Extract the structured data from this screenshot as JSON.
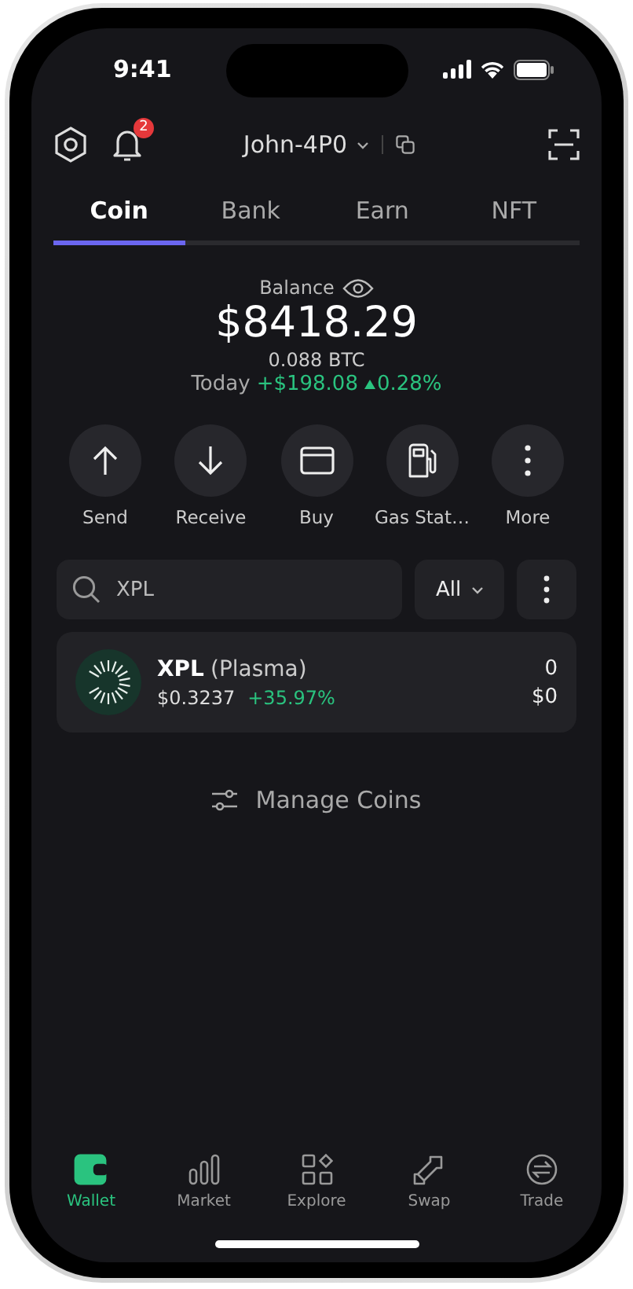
{
  "status_bar": {
    "time": "9:41"
  },
  "header": {
    "account": "John-4P0",
    "notification_count": "2"
  },
  "tabs": [
    {
      "label": "Coin",
      "selected": true
    },
    {
      "label": "Bank",
      "selected": false
    },
    {
      "label": "Earn",
      "selected": false
    },
    {
      "label": "NFT",
      "selected": false
    }
  ],
  "balance": {
    "label": "Balance",
    "amount": "$8418.29",
    "btc": "0.088 BTC",
    "today_label": "Today",
    "change": "+$198.08",
    "change_pct": "0.28%"
  },
  "actions": [
    {
      "kind": "send",
      "label": "Send"
    },
    {
      "kind": "receive",
      "label": "Receive"
    },
    {
      "kind": "buy",
      "label": "Buy"
    },
    {
      "kind": "gas",
      "label": "Gas Stat…"
    },
    {
      "kind": "more",
      "label": "More"
    }
  ],
  "search": {
    "value": "XPL"
  },
  "filter": {
    "label": "All"
  },
  "coins": [
    {
      "symbol": "XPL",
      "name": "(Plasma)",
      "price": "$0.3237",
      "change": "+35.97%",
      "amount": "0",
      "value": "$0"
    }
  ],
  "manage": {
    "label": "Manage Coins"
  },
  "nav": [
    {
      "kind": "wallet",
      "label": "Wallet",
      "selected": true
    },
    {
      "kind": "market",
      "label": "Market",
      "selected": false
    },
    {
      "kind": "explore",
      "label": "Explore",
      "selected": false
    },
    {
      "kind": "swap",
      "label": "Swap",
      "selected": false
    },
    {
      "kind": "trade",
      "label": "Trade",
      "selected": false
    }
  ]
}
